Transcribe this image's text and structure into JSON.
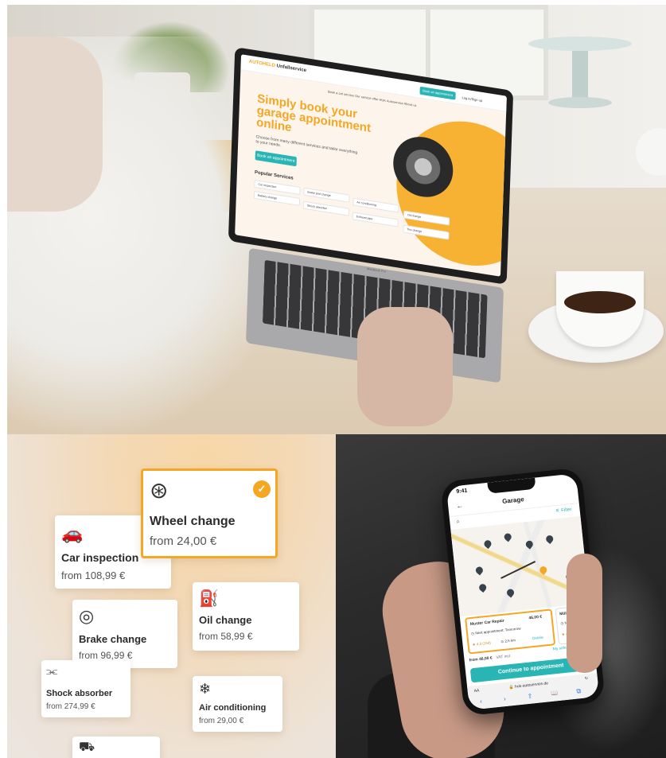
{
  "laptop_site": {
    "logo_prefix": "AUTOHELD",
    "logo_suffix": "Unfallservice",
    "nav": "Book a car service    Our service offer    HUK Autoservice    About us",
    "book_top": "Book an appointment",
    "login": "Log in/Sign up",
    "headline": "Simply book your garage appointment online",
    "subline": "Choose from many different services and tailor everything to your needs.",
    "cta": "Book an appointment",
    "popular_title": "Popular Services",
    "chips": [
      "Car inspection",
      "Brake pad change",
      "Air conditioning",
      "Oil change",
      "Battery change",
      "Shock absorber",
      "Exhaust pipe",
      "Tire change"
    ],
    "brand": "MacBook Pro"
  },
  "services": [
    {
      "icon_name": "wheel-icon",
      "icon": "⊛",
      "title": "Wheel change",
      "price": "from 24,00 €",
      "selected": true
    },
    {
      "icon_name": "car-icon",
      "icon": "🚗",
      "title": "Car inspection",
      "price": "from 108,99 €"
    },
    {
      "icon_name": "oil-can-icon",
      "icon": "⛽",
      "title": "Oil change",
      "price": "from 58,99 €"
    },
    {
      "icon_name": "brake-icon",
      "icon": "◎",
      "title": "Brake change",
      "price": "from 96,99 €"
    },
    {
      "icon_name": "shock-absorber-icon",
      "icon": "⫘",
      "title": "Shock absorber",
      "price": "from 274,99 €"
    },
    {
      "icon_name": "snowflake-icon",
      "icon": "❄",
      "title": "Air conditioning",
      "price": "from 29,00 €"
    },
    {
      "icon_name": "car-lift-icon",
      "icon": "⛟",
      "title": "",
      "price": ""
    }
  ],
  "phone": {
    "time": "9:41",
    "title": "Garage",
    "back": "←",
    "search_icon": "⌕",
    "filter": "⚟ Filter",
    "card1": {
      "name": "Muster Car Repair",
      "price": "46,00 €",
      "next": "◷ Next appointment: Tomorrow",
      "rating": "★ 4,3 (154)",
      "distance": "⊙ 2,5 km",
      "details": "Details"
    },
    "card2": {
      "name": "Müller KFZ",
      "next": "◷ Next ap",
      "rating": "★ 4,1 (22)"
    },
    "foot_price": "from 46,00 €",
    "foot_vat": "VAT incl.",
    "foot_selection": "My selection ^",
    "button": "Continue to appointment",
    "url_aa": "AA",
    "url": "🔒 huk-autoservice.de",
    "reload": "↻",
    "nav_icons": [
      "‹",
      "›",
      "⇧",
      "📖",
      "⧉"
    ]
  },
  "colors": {
    "accent": "#f5a623",
    "teal": "#2ab5b5"
  }
}
